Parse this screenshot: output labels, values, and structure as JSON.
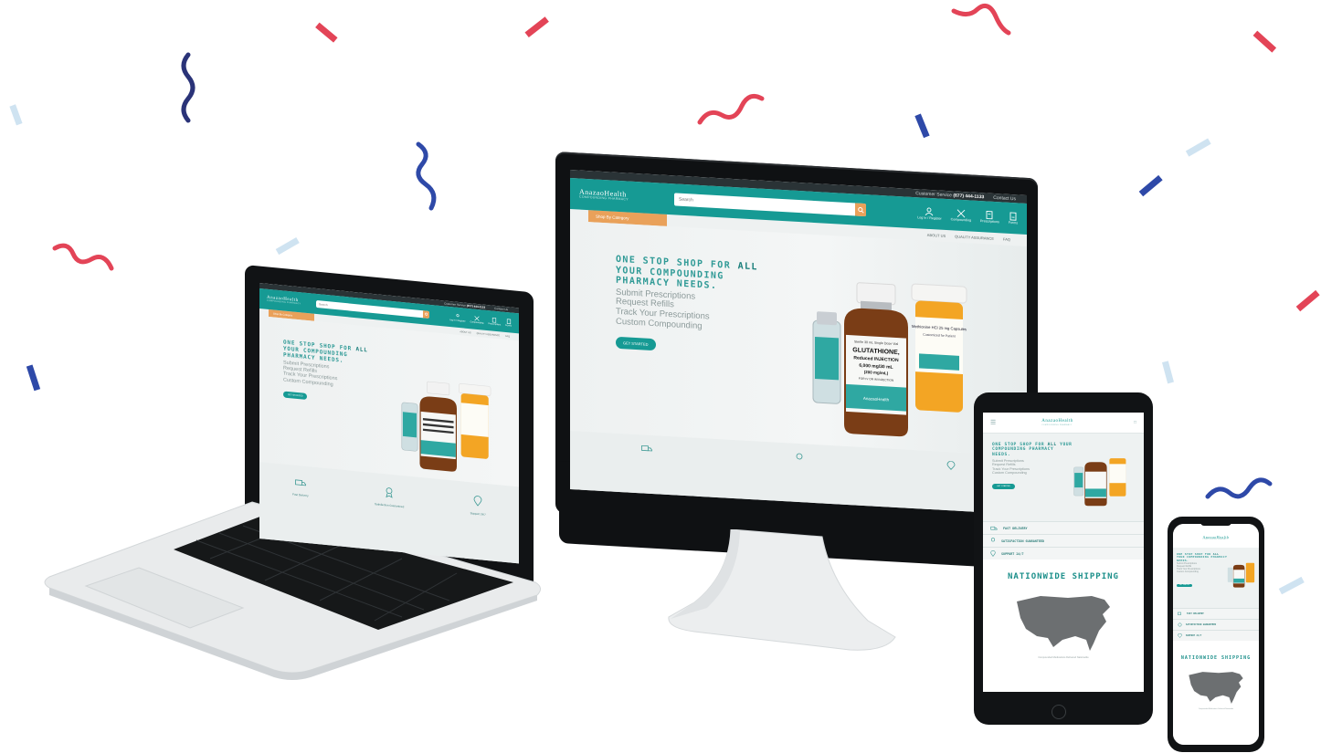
{
  "brand": {
    "name": "AnazaoHealth",
    "tagline": "COMPOUNDING PHARMACY",
    "primary_color": "#169a94",
    "accent_color": "#e9a15a",
    "dark_color": "#2a3336"
  },
  "site": {
    "topbar": {
      "customer_service_label": "Customer Service",
      "customer_service_phone": "(877) 444-1133",
      "contact_label": "Contact Us"
    },
    "search": {
      "placeholder": "Search",
      "button_icon": "search-icon"
    },
    "nav": [
      {
        "label": "Log In / Register",
        "icon": "user-icon"
      },
      {
        "label": "Compounding",
        "icon": "compounding-icon"
      },
      {
        "label": "Prescriptions",
        "icon": "prescription-icon"
      },
      {
        "label": "Forms",
        "icon": "forms-icon"
      }
    ],
    "category_button": "Shop By Category",
    "sublinks": [
      "ABOUT US",
      "QUALITY ASSURANCE",
      "FAQ"
    ],
    "hero": {
      "headline_prefix": "ONE STOP SHOP FOR",
      "headline_highlight": "ALL",
      "headline_rest": "YOUR COMPOUNDING PHARMACY NEEDS.",
      "list": [
        "Submit Prescriptions",
        "Request Refills",
        "Track Your Prescriptions",
        "Custom Compounding"
      ],
      "cta": "Get Started"
    },
    "product": {
      "bottle_label_small": "Sterile 30 mL Single Dose Vial",
      "bottle_name": "GLUTATHIONE,",
      "bottle_subname": "Reduced INJECTION",
      "bottle_dose": "6,000 mg/30 mL",
      "bottle_conc": "(200 mg/mL)",
      "bottle_note": "FOR IV OR IM INJECTION",
      "pill_label": "Methionine HCl 25 mg Capsules",
      "pill_label_2": "Customized for Patient",
      "vial_label": "Glutathione"
    },
    "features": [
      {
        "label": "Fast Delivery",
        "icon": "truck-icon"
      },
      {
        "label": "Satisfaction Guaranteed",
        "icon": "award-icon"
      },
      {
        "label": "Support 24/7",
        "icon": "location-pin-icon"
      }
    ],
    "shipping": {
      "title": "NATIONWIDE SHIPPING",
      "caption": "Compounded Medications Delivered Nationwide"
    }
  }
}
